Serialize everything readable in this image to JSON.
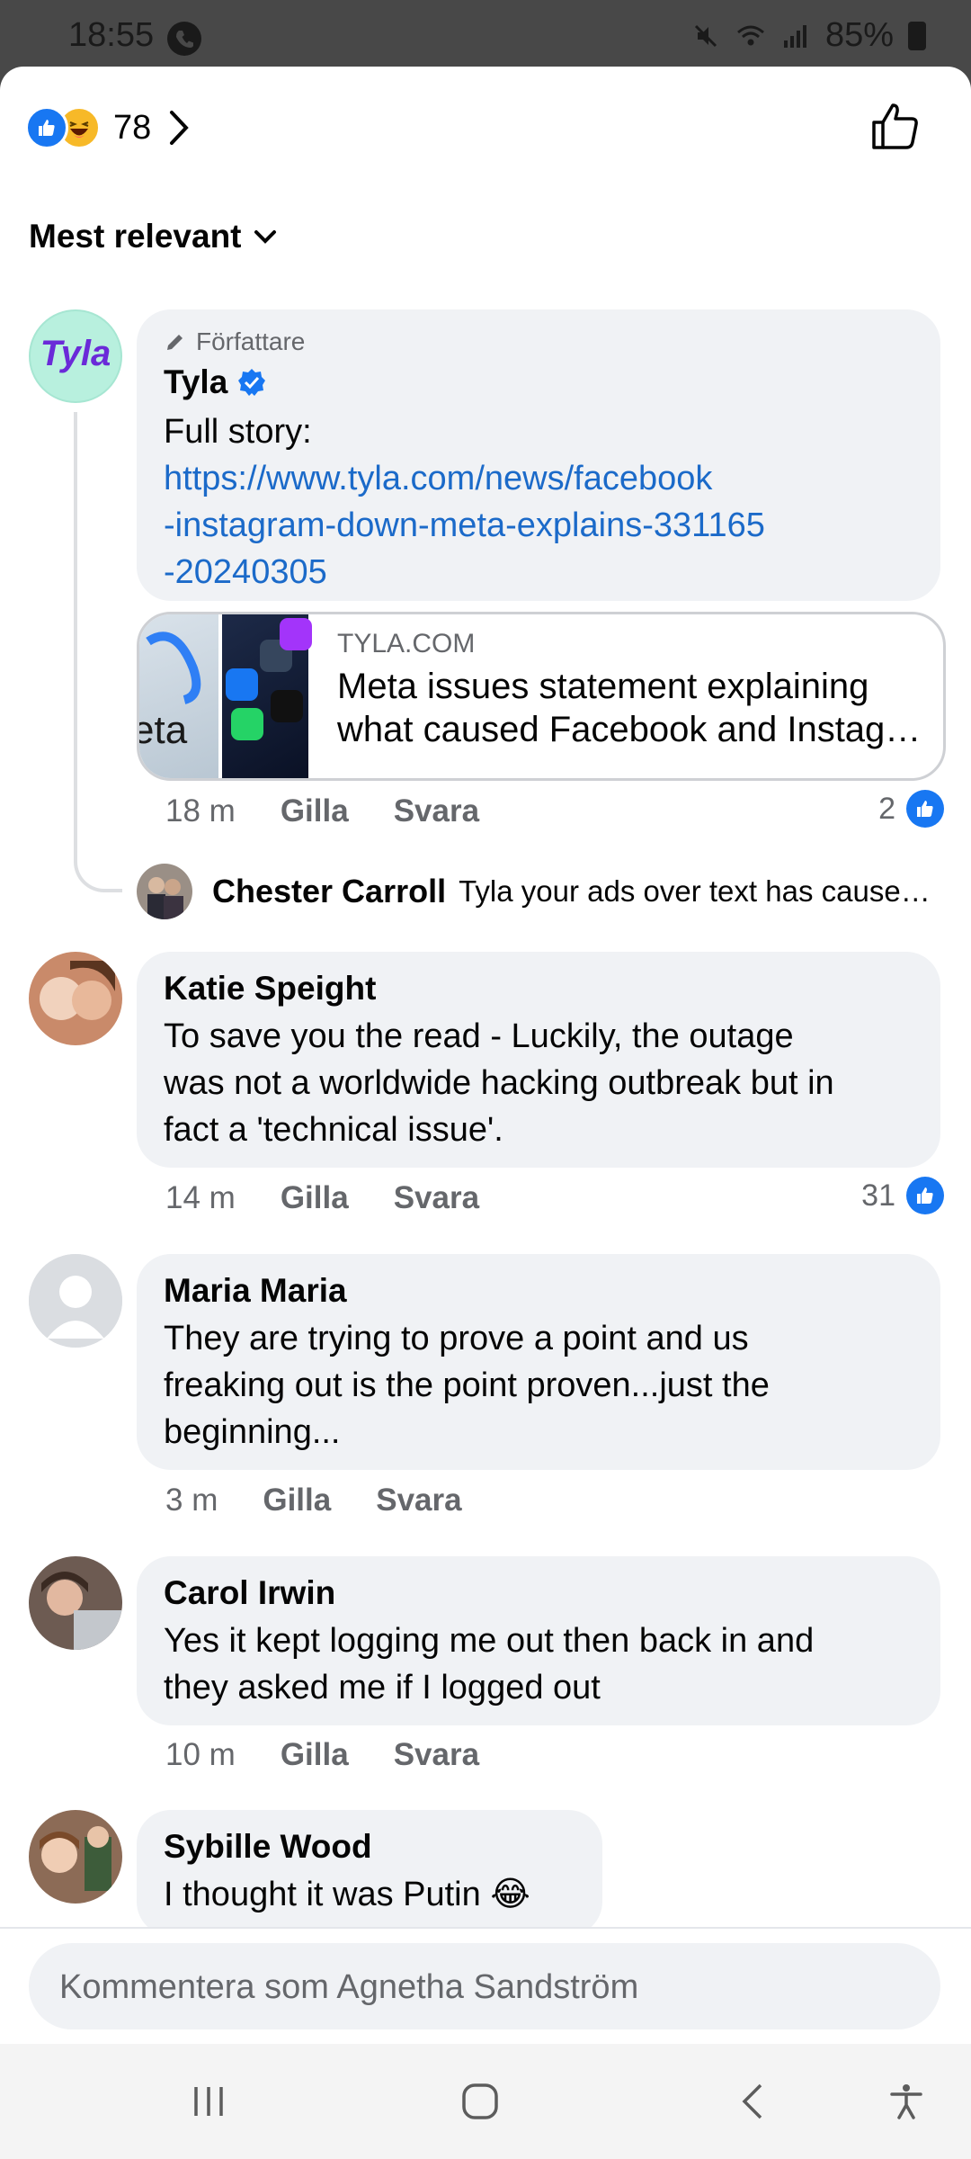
{
  "status_bar": {
    "time": "18:55",
    "battery": "85%"
  },
  "reactions": {
    "count": "78"
  },
  "sort": {
    "label": "Mest relevant"
  },
  "comments": [
    {
      "badge": "Författare",
      "name": "Tyla",
      "verified": true,
      "text_line1": "Full story:",
      "link_lines": [
        "https://www.tyla.com/news/facebook",
        "-instagram-down-meta-explains-331165",
        "-20240305"
      ],
      "link_preview": {
        "source": "TYLA.COM",
        "title_line1": "Meta issues statement explaining",
        "title_line2": "what caused Facebook and Instagram",
        "thumb_text": "eta"
      },
      "time": "18 m",
      "like": "Gilla",
      "reply": "Svara",
      "likes": "2"
    },
    {
      "name": "Katie Speight",
      "text_lines": [
        "To save you the read - Luckily, the outage",
        "was not a worldwide hacking outbreak but in",
        "fact a 'technical issue'."
      ],
      "time": "14 m",
      "like": "Gilla",
      "reply": "Svara",
      "likes": "31"
    },
    {
      "name": "Maria Maria",
      "text_lines": [
        "They are trying to prove a point and us",
        "freaking out is the point proven...just the",
        "beginning..."
      ],
      "time": "3 m",
      "like": "Gilla",
      "reply": "Svara"
    },
    {
      "name": "Carol Irwin",
      "text_lines": [
        "Yes it kept logging me out then back in and",
        "they asked me if I logged out"
      ],
      "time": "10 m",
      "like": "Gilla",
      "reply": "Svara"
    },
    {
      "name": "Sybille Wood",
      "text": "I thought it was Putin 😂"
    }
  ],
  "reply_preview": {
    "name": "Chester Carroll",
    "text": "Tyla your ads over text has caused havoc"
  },
  "composer": {
    "placeholder": "Kommentera som Agnetha Sandström"
  },
  "colors": {
    "accent": "#1877f2",
    "bubble": "#f0f2f5",
    "link": "#1b6ac9"
  }
}
